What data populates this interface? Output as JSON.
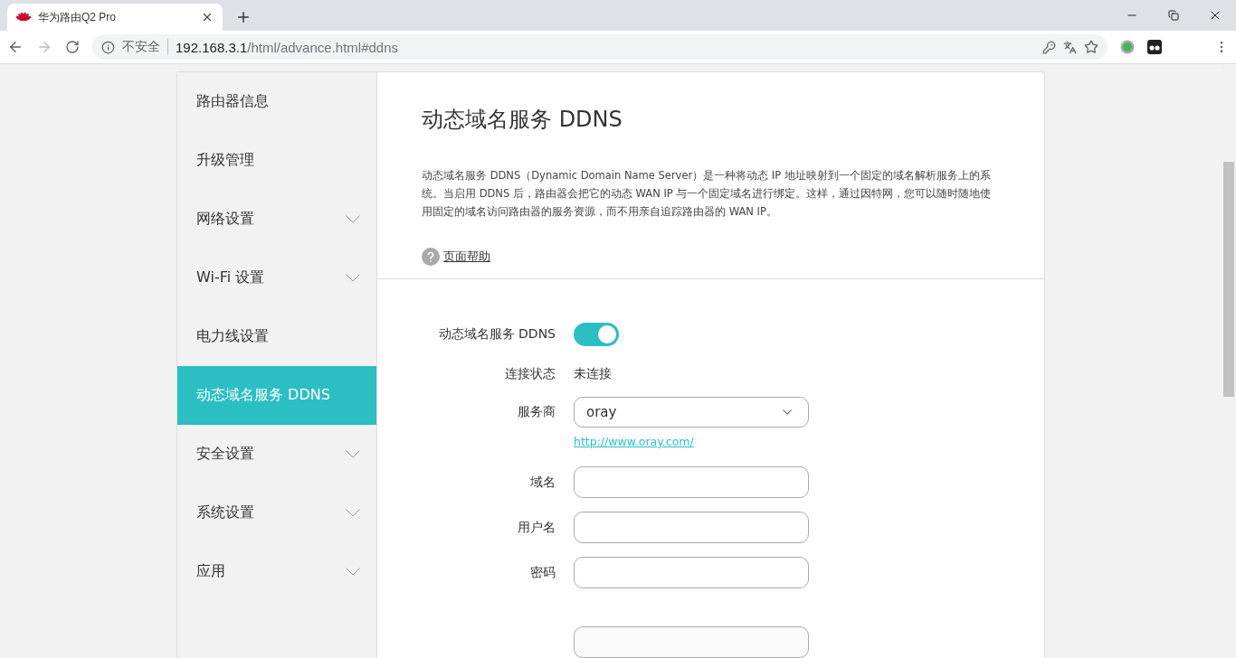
{
  "browser": {
    "tab_title": "华为路由Q2 Pro",
    "security_label": "不安全",
    "url_host": "192.168.3.1",
    "url_path": "/html/advance.html#ddns"
  },
  "sidebar": {
    "items": [
      {
        "label": "路由器信息",
        "expandable": false,
        "selected": false
      },
      {
        "label": "升级管理",
        "expandable": false,
        "selected": false
      },
      {
        "label": "网络设置",
        "expandable": true,
        "selected": false
      },
      {
        "label": "Wi-Fi 设置",
        "expandable": true,
        "selected": false
      },
      {
        "label": "电力线设置",
        "expandable": false,
        "selected": false
      },
      {
        "label": "动态域名服务 DDNS",
        "expandable": false,
        "selected": true
      },
      {
        "label": "安全设置",
        "expandable": true,
        "selected": false
      },
      {
        "label": "系统设置",
        "expandable": true,
        "selected": false
      },
      {
        "label": "应用",
        "expandable": true,
        "selected": false
      }
    ]
  },
  "content": {
    "title": "动态域名服务 DDNS",
    "description": "动态域名服务 DDNS（Dynamic Domain Name Server）是一种将动态 IP 地址映射到一个固定的域名解析服务上的系统。当启用 DDNS 后，路由器会把它的动态 WAN IP 与一个固定域名进行绑定。这样，通过因特网，您可以随时随地使用固定的域名访问路由器的服务资源，而不用亲自追踪路由器的 WAN IP。",
    "help_link": "页面帮助"
  },
  "form": {
    "rows": [
      {
        "kind": "toggle",
        "label": "动态域名服务 DDNS",
        "on": true
      },
      {
        "kind": "status",
        "label": "连接状态",
        "value": "未连接"
      },
      {
        "kind": "select",
        "label": "服务商",
        "value": "oray",
        "link": "http://www.oray.com/"
      },
      {
        "kind": "input",
        "label": "域名"
      },
      {
        "kind": "input",
        "label": "用户名"
      },
      {
        "kind": "input",
        "label": "密码"
      },
      {
        "kind": "input"
      }
    ]
  }
}
